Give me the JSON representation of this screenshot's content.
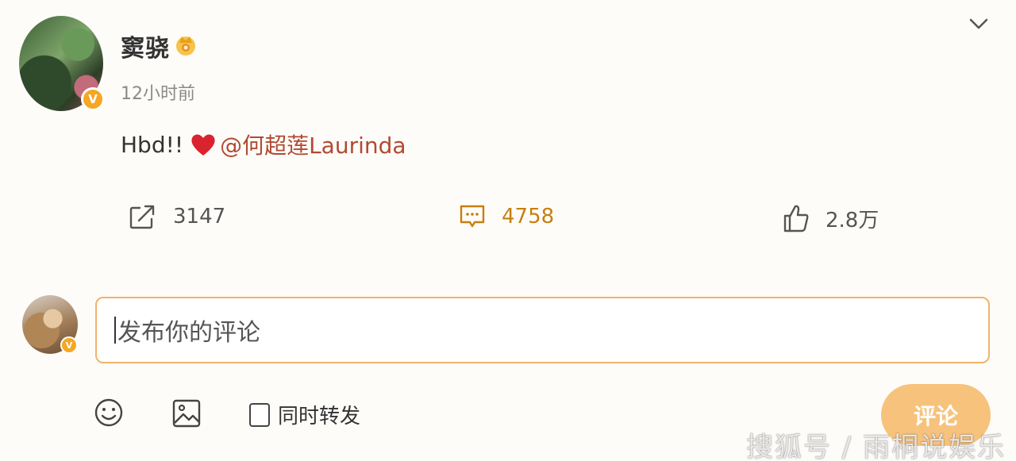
{
  "post": {
    "username": "窦骁",
    "timestamp": "12小时前",
    "text_prefix": "Hbd!! ",
    "mention": "@何超莲Laurinda",
    "verify_symbol": "V"
  },
  "actions": {
    "repost_count": "3147",
    "comment_count": "4758",
    "like_count": "2.8万"
  },
  "composer": {
    "placeholder": "发布你的评论",
    "also_repost_label": "同时转发",
    "submit_label": "评论"
  },
  "watermark": "搜狐号 / 雨桐说娱乐",
  "colors": {
    "accent": "#f5a623",
    "mention": "#b04a33",
    "comment_active": "#c77f10",
    "input_border": "#f0b46a",
    "submit_bg": "#f7c27c"
  },
  "icons": [
    "crown-icon",
    "chevron-down-icon",
    "heart-icon",
    "repost-icon",
    "comment-icon",
    "like-icon",
    "emoji-icon",
    "image-icon"
  ]
}
